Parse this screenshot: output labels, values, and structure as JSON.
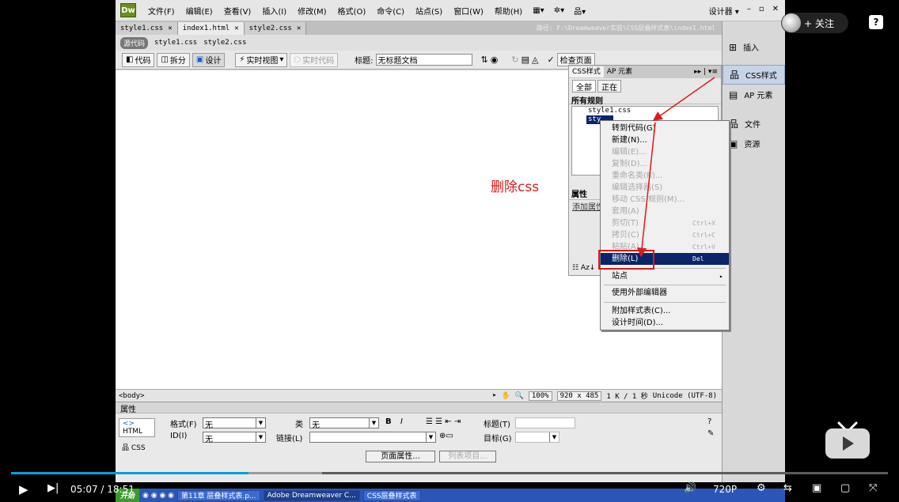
{
  "app": {
    "logo": "Dw",
    "menus": [
      "文件(F)",
      "编辑(E)",
      "查看(V)",
      "插入(I)",
      "修改(M)",
      "格式(O)",
      "命令(C)",
      "站点(S)",
      "窗口(W)",
      "帮助(H)"
    ],
    "workspace": "设计器 ▾"
  },
  "doc_tabs": [
    {
      "label": "style1.css",
      "active": false
    },
    {
      "label": "index1.html",
      "active": true
    },
    {
      "label": "style2.css",
      "active": false
    }
  ],
  "path": "路径: F:\\Dreamweaver实验\\CSS层叠样式表\\index1.html",
  "related": {
    "source_label": "源代码",
    "files": [
      "style1.css",
      "style2.css"
    ]
  },
  "doc_toolbar": {
    "code": "代码",
    "split": "拆分",
    "design": "设计",
    "live_view": "实时视图",
    "live_code": "实时代码",
    "title_label": "标题:",
    "title_value": "无标题文档",
    "check_page": "检查页面"
  },
  "status_bar": {
    "tag": "<body>",
    "zoom": "100%",
    "size": "920 x 485",
    "filesize": "1 K / 1 秒",
    "encoding": "Unicode (UTF-8)"
  },
  "properties": {
    "header": "属性",
    "html_btn": "HTML",
    "css_btn": "CSS",
    "format_label": "格式(F)",
    "format_value": "无",
    "class_label": "类",
    "class_value": "无",
    "id_label": "ID(I)",
    "id_value": "无",
    "link_label": "链接(L)",
    "title_label": "标题(T)",
    "target_label": "目标(G)",
    "page_props": "页面属性...",
    "list_item": "列表项目..."
  },
  "right_panel": {
    "items": [
      {
        "label": "插入",
        "icon": "insert-icon",
        "highlighted": false
      },
      {
        "label": "CSS样式",
        "icon": "css-styles-icon",
        "highlighted": true
      },
      {
        "label": "AP 元素",
        "icon": "ap-elements-icon",
        "highlighted": false
      },
      {
        "label": "文件",
        "icon": "files-icon",
        "highlighted": false
      },
      {
        "label": "资源",
        "icon": "assets-icon",
        "highlighted": false
      }
    ]
  },
  "css_panel": {
    "tabs": [
      "CSS样式",
      "AP 元素"
    ],
    "mode_all": "全部",
    "mode_current": "正在",
    "all_rules": "所有规则",
    "rules": [
      "style1.css",
      "sty"
    ],
    "attributes": "属性",
    "add_attr": "添加属性"
  },
  "context_menu": {
    "items": [
      {
        "label": "转到代码(G)",
        "shortcut": "",
        "disabled": false
      },
      {
        "label": "新建(N)...",
        "shortcut": "",
        "disabled": false
      },
      {
        "label": "编辑(E)...",
        "shortcut": "",
        "disabled": true
      },
      {
        "label": "复制(D)...",
        "shortcut": "",
        "disabled": true
      },
      {
        "label": "重命名类(R)...",
        "shortcut": "",
        "disabled": true
      },
      {
        "label": "编辑选择器(S)",
        "shortcut": "",
        "disabled": true
      },
      {
        "label": "移动 CSS 规则(M)...",
        "shortcut": "",
        "disabled": true
      },
      {
        "label": "套用(A)",
        "shortcut": "",
        "disabled": true
      },
      {
        "label": "剪切(T)",
        "shortcut": "Ctrl+X",
        "disabled": true
      },
      {
        "label": "拷贝(C)",
        "shortcut": "Ctrl+C",
        "disabled": true
      },
      {
        "label": "粘贴(A)",
        "shortcut": "Ctrl+V",
        "disabled": true
      },
      {
        "label": "删除(L)",
        "shortcut": "Del",
        "disabled": false,
        "highlighted": true
      },
      {
        "label": "站点",
        "shortcut": "▸",
        "disabled": false
      },
      {
        "label": "使用外部编辑器",
        "shortcut": "",
        "disabled": false
      },
      {
        "label": "附加样式表(C)...",
        "shortcut": "",
        "disabled": false
      },
      {
        "label": "设计时间(D)...",
        "shortcut": "",
        "disabled": false
      }
    ]
  },
  "annotation": "删除css",
  "player": {
    "follow": "+ 关注",
    "time_current": "05:07",
    "time_total": "18:51",
    "progress_fraction": 0.271,
    "buffered_fraction": 0.355,
    "quality": "720P",
    "accent": "#00a1d6"
  },
  "taskbar": {
    "start": "开始",
    "items": [
      "第11章 层叠样式表.p...",
      "Adobe Dreamweaver C...",
      "CSS层叠样式表"
    ]
  }
}
